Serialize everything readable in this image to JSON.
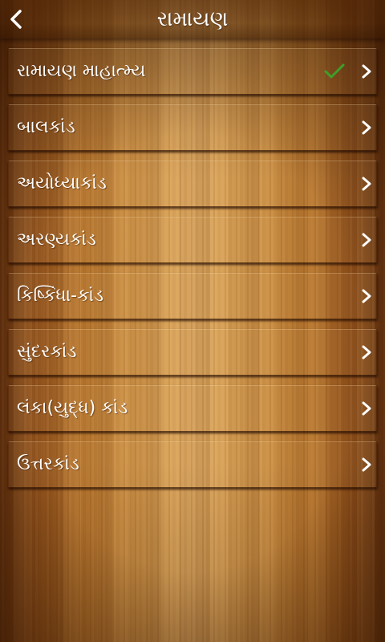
{
  "header": {
    "title": "રામાયણ",
    "back_icon": "chevron-left-icon"
  },
  "list": {
    "items": [
      {
        "label": "રામાયણ માહાત્મ્ય",
        "checked": true
      },
      {
        "label": "બાલકાંડ",
        "checked": false
      },
      {
        "label": "અયોધ્યાકાંડ",
        "checked": false
      },
      {
        "label": "અરણ્યકાંડ",
        "checked": false
      },
      {
        "label": "કિષ્કિંધા-કાંડ",
        "checked": false
      },
      {
        "label": "સુંદરકાંડ",
        "checked": false
      },
      {
        "label": "લંકા(યુદ્ધ) કાંડ",
        "checked": false
      },
      {
        "label": "ઉત્તરકાંડ",
        "checked": false
      }
    ]
  },
  "icons": {
    "back": "chevron-left-icon",
    "row_arrow": "chevron-right-icon",
    "read_mark": "check-icon"
  },
  "colors": {
    "text": "#ffffff",
    "check": "#3f9e2b",
    "wood_light": "#dca861",
    "wood_dark": "#5e2f0e"
  }
}
